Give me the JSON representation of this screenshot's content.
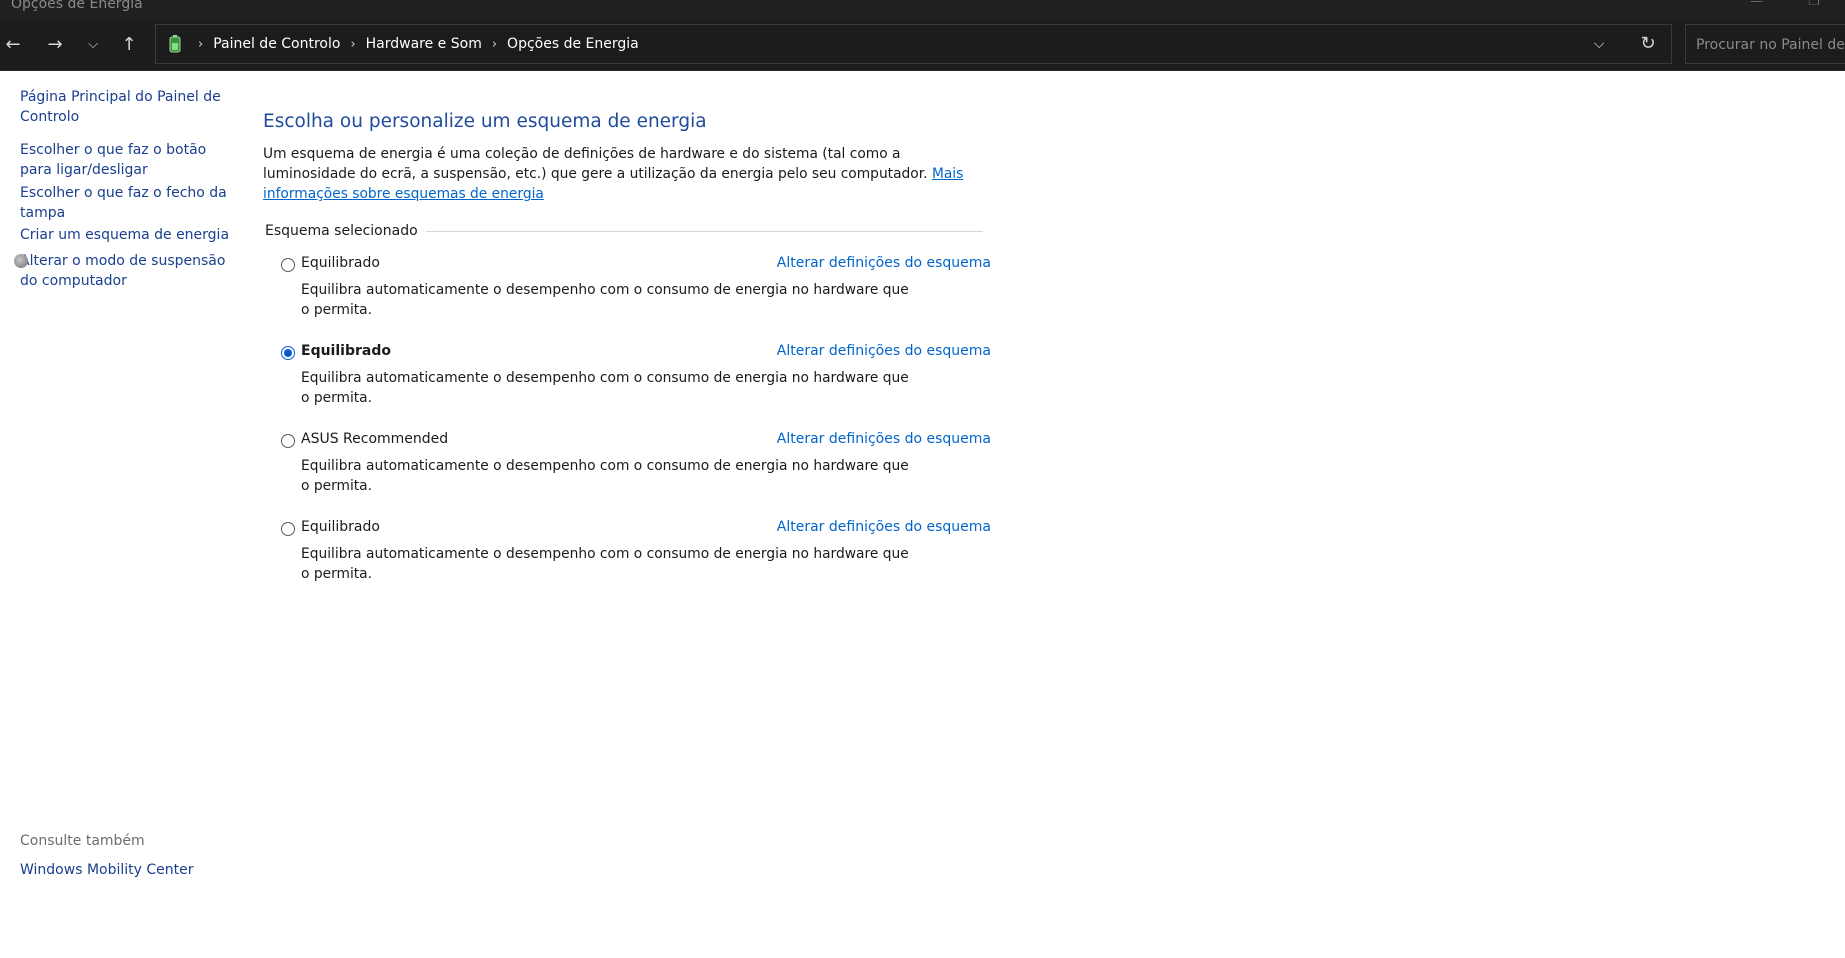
{
  "window": {
    "title": "Opções de Energia"
  },
  "navigation": {
    "back_icon": "arrow-left-icon",
    "forward_icon": "arrow-right-icon",
    "recent_icon": "chevron-down-icon",
    "up_icon": "arrow-up-icon"
  },
  "address": {
    "icon": "power-options-icon",
    "crumbs": [
      "Painel de Controlo",
      "Hardware e Som",
      "Opções de Energia"
    ],
    "dropdown_icon": "chevron-down-icon",
    "refresh_icon": "refresh-icon"
  },
  "search": {
    "placeholder": "Procurar no Painel de..."
  },
  "sidebar": {
    "links": [
      "Página Principal do Painel de Controlo",
      "Escolher o que faz o botão para ligar/desligar",
      "Escolher o que faz o fecho da tampa",
      "Criar um esquema de energia",
      "Alterar o modo de suspensão do computador"
    ],
    "see_also_label": "Consulte também",
    "see_also_links": [
      "Windows Mobility Center"
    ]
  },
  "main": {
    "heading": "Escolha ou personalize um esquema de energia",
    "description": "Um esquema de energia é uma coleção de definições de hardware e do sistema (tal como a luminosidade do ecrã, a suspensão, etc.) que gere a utilização da energia pelo seu computador.",
    "description_link": "Mais informações sobre esquemas de energia",
    "group_label": "Esquema selecionado",
    "plans": [
      {
        "name": "Equilibrado",
        "selected": false,
        "link": "Alterar definições do esquema",
        "description": "Equilibra automaticamente o desempenho com o consumo de energia no hardware que o permita."
      },
      {
        "name": "Equilibrado",
        "selected": true,
        "link": "Alterar definições do esquema",
        "description": "Equilibra automaticamente o desempenho com o consumo de energia no hardware que o permita."
      },
      {
        "name": "ASUS Recommended",
        "selected": false,
        "link": "Alterar definições do esquema",
        "description": "Equilibra automaticamente o desempenho com o consumo de energia no hardware que o permita."
      },
      {
        "name": "Equilibrado",
        "selected": false,
        "link": "Alterar definições do esquema",
        "description": "Equilibra automaticamente o desempenho com o consumo de energia no hardware que o permita."
      }
    ]
  },
  "colors": {
    "accent": "#0a5bd3",
    "link": "#0066cc",
    "heading": "#1e4b9c",
    "titlebar": "#202020"
  }
}
